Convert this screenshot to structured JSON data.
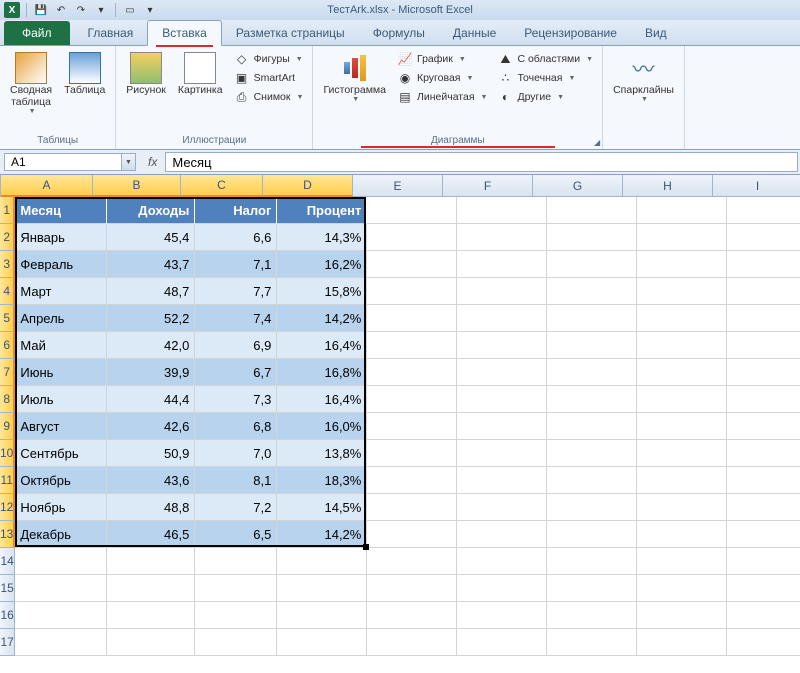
{
  "app": {
    "title": "ТестArk.xlsx - Microsoft Excel"
  },
  "qat": {
    "save": "save",
    "undo": "undo",
    "redo": "redo",
    "print": "print",
    "new": "new"
  },
  "tabs": {
    "file": "Файл",
    "items": [
      "Главная",
      "Вставка",
      "Разметка страницы",
      "Формулы",
      "Данные",
      "Рецензирование",
      "Вид"
    ],
    "active": "Вставка"
  },
  "ribbon": {
    "tables": {
      "label": "Таблицы",
      "pivot": "Сводная\nтаблица",
      "table": "Таблица"
    },
    "illus": {
      "label": "Иллюстрации",
      "picture": "Рисунок",
      "clipart": "Картинка",
      "shapes": "Фигуры",
      "smartart": "SmartArt",
      "screenshot": "Снимок"
    },
    "charts": {
      "label": "Диаграммы",
      "histogram": "Гистограмма",
      "line": "График",
      "pie": "Круговая",
      "bar": "Линейчатая",
      "area": "С областями",
      "scatter": "Точечная",
      "other": "Другие"
    },
    "spark": {
      "label": "",
      "sparklines": "Спарклайны"
    }
  },
  "namebox": "A1",
  "formula": "Месяц",
  "columns": [
    "A",
    "B",
    "C",
    "D",
    "E",
    "F",
    "G",
    "H",
    "I"
  ],
  "sel_cols": 4,
  "sel_rows": 13,
  "headers": [
    "Месяц",
    "Доходы",
    "Налог",
    "Процент"
  ],
  "rows": [
    {
      "m": "Январь",
      "d": "45,4",
      "n": "6,6",
      "p": "14,3%"
    },
    {
      "m": "Февраль",
      "d": "43,7",
      "n": "7,1",
      "p": "16,2%"
    },
    {
      "m": "Март",
      "d": "48,7",
      "n": "7,7",
      "p": "15,8%"
    },
    {
      "m": "Апрель",
      "d": "52,2",
      "n": "7,4",
      "p": "14,2%"
    },
    {
      "m": "Май",
      "d": "42,0",
      "n": "6,9",
      "p": "16,4%"
    },
    {
      "m": "Июнь",
      "d": "39,9",
      "n": "6,7",
      "p": "16,8%"
    },
    {
      "m": "Июль",
      "d": "44,4",
      "n": "7,3",
      "p": "16,4%"
    },
    {
      "m": "Август",
      "d": "42,6",
      "n": "6,8",
      "p": "16,0%"
    },
    {
      "m": "Сентябрь",
      "d": "50,9",
      "n": "7,0",
      "p": "13,8%"
    },
    {
      "m": "Октябрь",
      "d": "43,6",
      "n": "8,1",
      "p": "18,3%"
    },
    {
      "m": "Ноябрь",
      "d": "48,8",
      "n": "7,2",
      "p": "14,5%"
    },
    {
      "m": "Декабрь",
      "d": "46,5",
      "n": "6,5",
      "p": "14,2%"
    }
  ],
  "visible_rows": 17
}
